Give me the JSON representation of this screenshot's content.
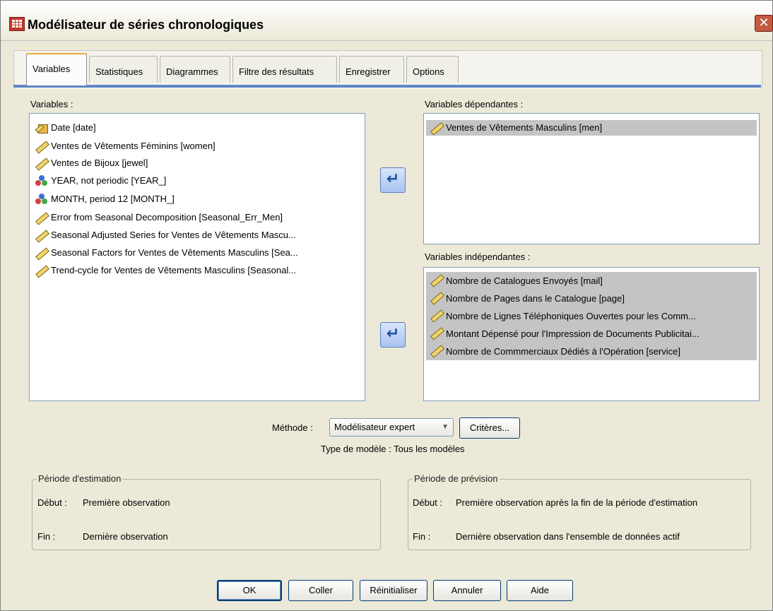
{
  "window": {
    "title": "Modélisateur de séries chronologiques",
    "close_glyph": "✕"
  },
  "tabs": [
    {
      "label": "Variables",
      "active": true
    },
    {
      "label": "Statistiques"
    },
    {
      "label": "Diagrammes"
    },
    {
      "label": "Filtre des résultats"
    },
    {
      "label": "Enregistrer"
    },
    {
      "label": "Options"
    }
  ],
  "variables_panel": {
    "label": "Variables :",
    "items": [
      {
        "text": "Date [date]",
        "icon": "date-icon"
      },
      {
        "text": "Ventes de Vêtements Féminins [women]",
        "icon": "scale-icon"
      },
      {
        "text": "Ventes de Bijoux [jewel]",
        "icon": "scale-icon"
      },
      {
        "text": "YEAR, not periodic [YEAR_]",
        "icon": "nominal-icon"
      },
      {
        "text": "MONTH, period 12 [MONTH_]",
        "icon": "nominal-icon"
      },
      {
        "text": "Error from Seasonal Decomposition [Seasonal_Err_Men]",
        "icon": "scale-icon"
      },
      {
        "text": "Seasonal Adjusted Series for Ventes de Vêtements Mascu...",
        "icon": "scale-icon"
      },
      {
        "text": "Seasonal Factors for Ventes de Vêtements Masculins [Sea...",
        "icon": "scale-icon"
      },
      {
        "text": "Trend-cycle for Ventes de Vêtements Masculins [Seasonal...",
        "icon": "scale-icon"
      }
    ]
  },
  "dependent_panel": {
    "label": "Variables dépendantes :",
    "items": [
      {
        "text": "Ventes de Vêtements Masculins [men]",
        "icon": "scale-icon"
      }
    ]
  },
  "independent_panel": {
    "label": "Variables indépendantes :",
    "items": [
      {
        "text": "Nombre de Catalogues Envoyés [mail]",
        "icon": "scale-icon"
      },
      {
        "text": "Nombre de Pages dans le Catalogue [page]",
        "icon": "scale-icon"
      },
      {
        "text": "Nombre de Lignes Téléphoniques Ouvertes pour les Comm...",
        "icon": "scale-icon"
      },
      {
        "text": "Montant Dépensé pour l'Impression de Documents Publicitai...",
        "icon": "scale-icon"
      },
      {
        "text": "Nombre de Commmerciaux Dédiés à l'Opération [service]",
        "icon": "scale-icon"
      }
    ]
  },
  "arrow_glyph": "↵",
  "method": {
    "label": "Méthode :",
    "selected": "Modélisateur expert",
    "criteria_button": "Critères..."
  },
  "model_type": {
    "text": "Type de modèle : Tous les modèles"
  },
  "estimation": {
    "title": "Période d'estimation",
    "start_label": "Début :",
    "start_value": "Première observation",
    "end_label": "Fin :",
    "end_value": "Dernière observation"
  },
  "forecast": {
    "title": "Période de prévision",
    "start_label": "Début :",
    "start_value": "Première observation après la fin de la période d'estimation",
    "end_label": "Fin :",
    "end_value": "Dernière observation dans l'ensemble de données actif"
  },
  "buttons": {
    "ok": "OK",
    "paste": "Coller",
    "reset": "Réinitialiser",
    "cancel": "Annuler",
    "help": "Aide"
  },
  "colors": {
    "selected_row": "#c4c4c4",
    "tab_accent": "#5f87c7",
    "close_button": "#c45a41"
  }
}
